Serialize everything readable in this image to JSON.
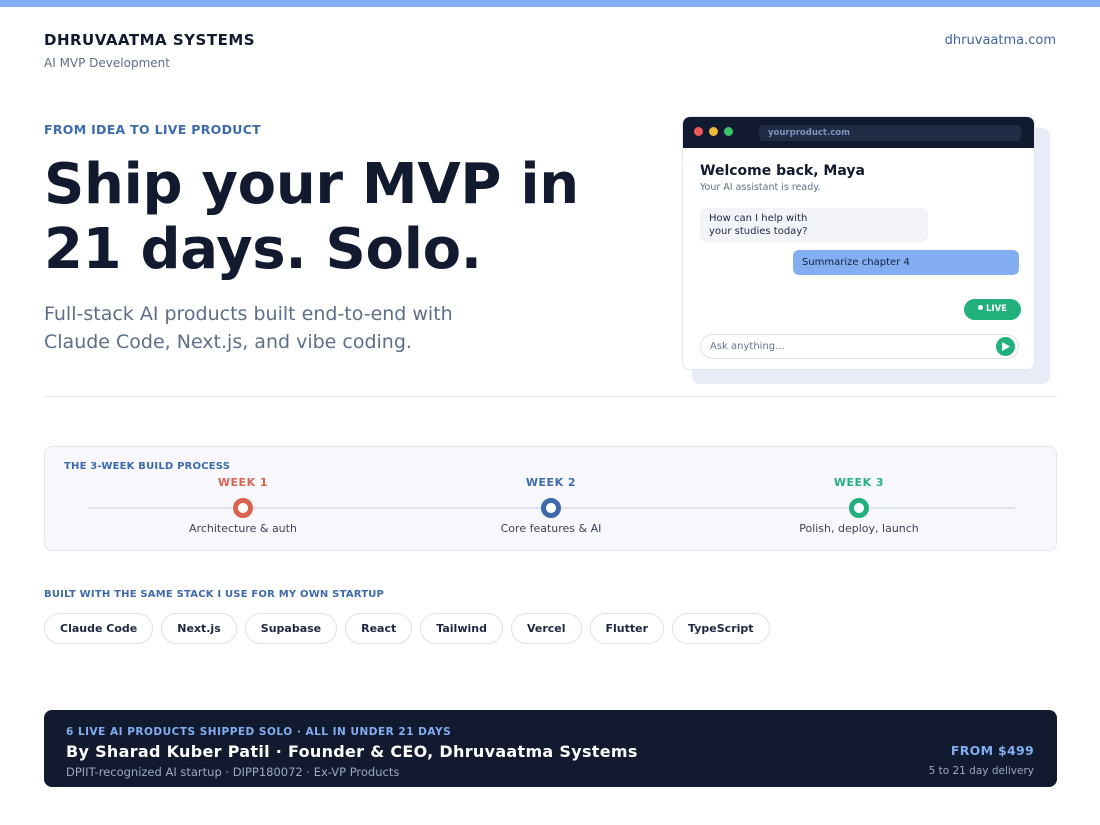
{
  "header": {
    "brand": "DHRUVAATMA SYSTEMS",
    "tagline": "AI MVP Development",
    "site_link": "dhruvaatma.com"
  },
  "hero": {
    "eyebrow": "FROM IDEA TO LIVE PRODUCT",
    "headline_line1": "Ship your MVP in",
    "headline_line2": "21 days. Solo.",
    "subline_line1": "Full-stack AI products built end-to-end with",
    "subline_line2": "Claude Code, Next.js, and vibe coding."
  },
  "mockup": {
    "url": "yourproduct.com",
    "title": "Welcome back, Maya",
    "subtitle": "Your AI assistant is ready.",
    "incoming_line1": "How can I help with",
    "incoming_line2": "your studies today?",
    "outgoing": "Summarize chapter 4",
    "live_badge": "LIVE",
    "input_placeholder": "Ask anything..."
  },
  "process": {
    "title": "THE 3-WEEK BUILD PROCESS",
    "steps": [
      {
        "week": "WEEK 1",
        "label": "Architecture & auth",
        "color": "#d9634f"
      },
      {
        "week": "WEEK 2",
        "label": "Core features & AI",
        "color": "#3d6aab"
      },
      {
        "week": "WEEK 3",
        "label": "Polish, deploy, launch",
        "color": "#22b07d"
      }
    ]
  },
  "stack": {
    "title": "BUILT WITH THE SAME STACK I USE FOR MY OWN STARTUP",
    "items": [
      "Claude Code",
      "Next.js",
      "Supabase",
      "React",
      "Tailwind",
      "Vercel",
      "Flutter",
      "TypeScript"
    ]
  },
  "footer": {
    "eyebrow": "6 LIVE AI PRODUCTS SHIPPED SOLO  ·  ALL IN UNDER 21 DAYS",
    "title": "By Sharad Kuber Patil  ·  Founder & CEO, Dhruvaatma Systems",
    "subtitle": "DPIIT-recognized AI startup  ·  DIPP180072  ·  Ex-VP Products",
    "price": "FROM $499",
    "delivery": "5 to 21 day delivery"
  },
  "colors": {
    "accent": "#84aef2",
    "navy": "#111a2e",
    "link": "#3d64a3",
    "success": "#22b07d",
    "week1": "#d9634f"
  },
  "icons": {
    "send": "send-arrow-icon",
    "live": "live-dot-icon"
  }
}
